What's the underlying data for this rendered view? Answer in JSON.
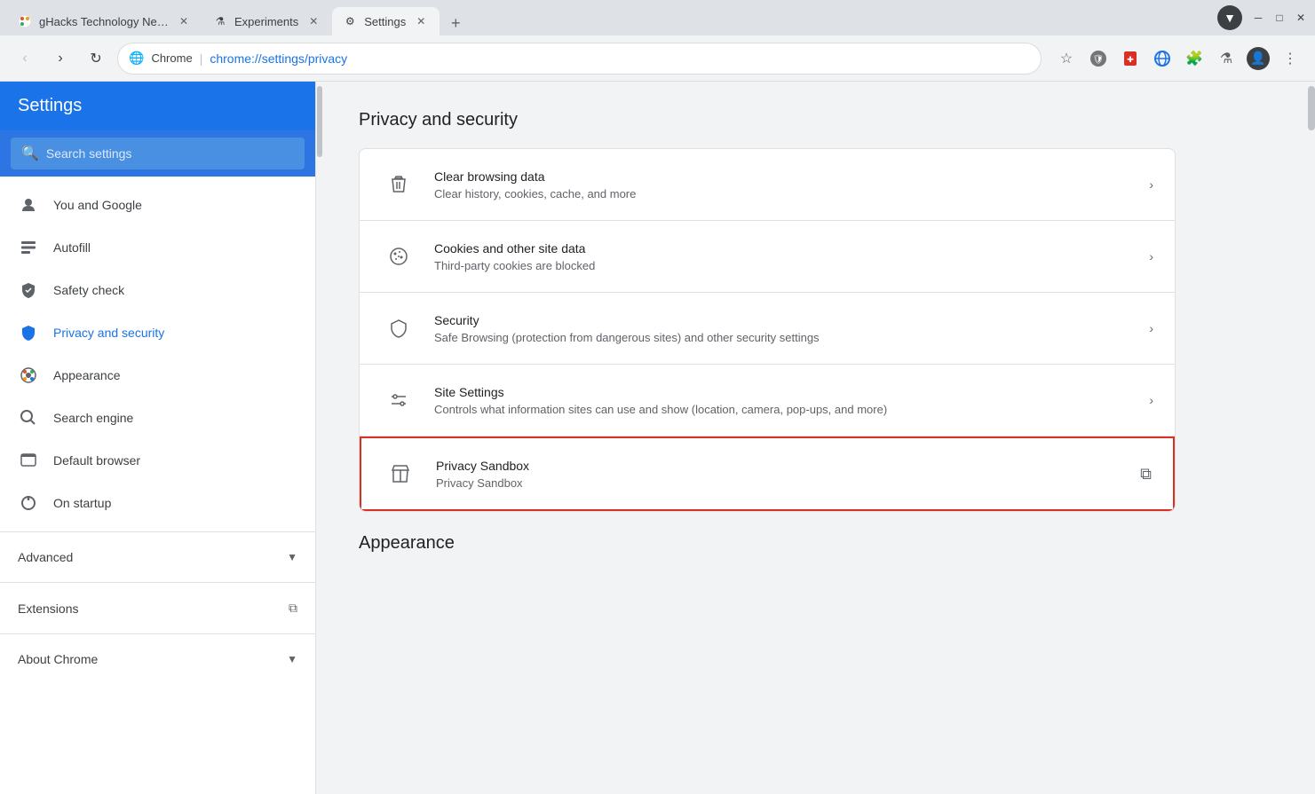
{
  "browser": {
    "tabs": [
      {
        "id": "tab1",
        "favicon": "🔴🟡🟢",
        "label": "gHacks Technology News",
        "active": false
      },
      {
        "id": "tab2",
        "favicon": "🧪",
        "label": "Experiments",
        "active": false
      },
      {
        "id": "tab3",
        "favicon": "⚙",
        "label": "Settings",
        "active": true
      }
    ],
    "address_bar": {
      "favicon": "🌐",
      "brand": "Chrome",
      "url_prefix": "chrome://",
      "url_highlight": "settings",
      "url_suffix": "/privacy"
    },
    "toolbar_icons": {
      "star": "☆",
      "shield1": "🛡",
      "shield2": "🛡",
      "puzzle": "🧩",
      "flask": "⚗",
      "profile": "👤",
      "menu": "⋮"
    }
  },
  "sidebar": {
    "title": "Settings",
    "search_placeholder": "Search settings",
    "nav_items": [
      {
        "id": "you-and-google",
        "icon": "person",
        "label": "You and Google",
        "active": false
      },
      {
        "id": "autofill",
        "icon": "list",
        "label": "Autofill",
        "active": false
      },
      {
        "id": "safety-check",
        "icon": "check-shield",
        "label": "Safety check",
        "active": false
      },
      {
        "id": "privacy-security",
        "icon": "shield-blue",
        "label": "Privacy and security",
        "active": true
      },
      {
        "id": "appearance",
        "icon": "palette",
        "label": "Appearance",
        "active": false
      },
      {
        "id": "search-engine",
        "icon": "search",
        "label": "Search engine",
        "active": false
      },
      {
        "id": "default-browser",
        "icon": "browser",
        "label": "Default browser",
        "active": false
      },
      {
        "id": "on-startup",
        "icon": "power",
        "label": "On startup",
        "active": false
      }
    ],
    "advanced": {
      "label": "Advanced",
      "expanded": false
    },
    "extensions": {
      "label": "Extensions",
      "icon": "external-link"
    },
    "about": {
      "label": "About Chrome"
    }
  },
  "content": {
    "section_title": "Privacy and security",
    "appearance_section_title": "Appearance",
    "settings_items": [
      {
        "id": "clear-browsing",
        "icon": "trash",
        "title": "Clear browsing data",
        "subtitle": "Clear history, cookies, cache, and more",
        "arrow": "›",
        "highlighted": false
      },
      {
        "id": "cookies",
        "icon": "cookie",
        "title": "Cookies and other site data",
        "subtitle": "Third-party cookies are blocked",
        "arrow": "›",
        "highlighted": false
      },
      {
        "id": "security",
        "icon": "security-shield",
        "title": "Security",
        "subtitle": "Safe Browsing (protection from dangerous sites) and other security settings",
        "arrow": "›",
        "highlighted": false
      },
      {
        "id": "site-settings",
        "icon": "sliders",
        "title": "Site Settings",
        "subtitle": "Controls what information sites can use and show (location, camera, pop-ups, and more)",
        "arrow": "›",
        "highlighted": false
      },
      {
        "id": "privacy-sandbox",
        "icon": "flask",
        "title": "Privacy Sandbox",
        "subtitle": "Privacy Sandbox",
        "ext_icon": "⧉",
        "highlighted": true
      }
    ]
  }
}
